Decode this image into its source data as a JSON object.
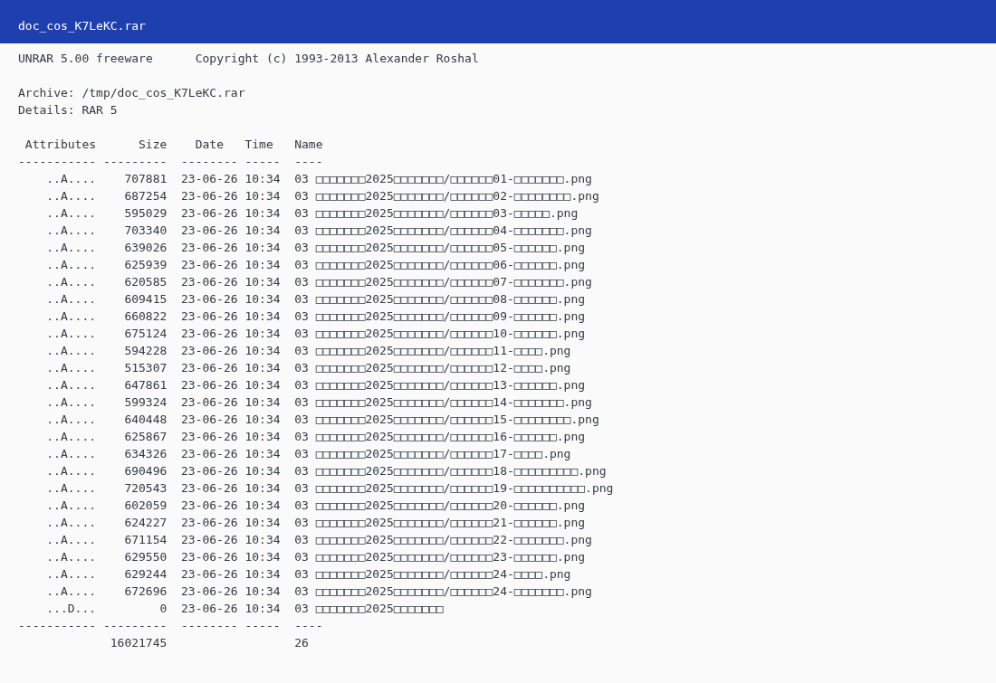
{
  "window": {
    "title": "doc_cos_K7LeKC.rar"
  },
  "banner": {
    "program": "UNRAR 5.00 freeware",
    "copyright": "Copyright (c) 1993-2013 Alexander Roshal"
  },
  "archive": {
    "archive_line": "Archive: /tmp/doc_cos_K7LeKC.rar",
    "details_line": "Details: RAR 5"
  },
  "table": {
    "columns": [
      "Attributes",
      "Size",
      "Date",
      "Time",
      "Name"
    ],
    "separator_top": [
      "-----------",
      "---------",
      "--------",
      "-----",
      "----"
    ],
    "rows": [
      {
        "attributes": "..A....",
        "size": "707881",
        "date": "23-06-26",
        "time": "10:34",
        "name": "03 □□□□□□□2025□□□□□□□/□□□□□□01-□□□□□□□.png"
      },
      {
        "attributes": "..A....",
        "size": "687254",
        "date": "23-06-26",
        "time": "10:34",
        "name": "03 □□□□□□□2025□□□□□□□/□□□□□□02-□□□□□□□□.png"
      },
      {
        "attributes": "..A....",
        "size": "595029",
        "date": "23-06-26",
        "time": "10:34",
        "name": "03 □□□□□□□2025□□□□□□□/□□□□□□03-□□□□□.png"
      },
      {
        "attributes": "..A....",
        "size": "703340",
        "date": "23-06-26",
        "time": "10:34",
        "name": "03 □□□□□□□2025□□□□□□□/□□□□□□04-□□□□□□□.png"
      },
      {
        "attributes": "..A....",
        "size": "639026",
        "date": "23-06-26",
        "time": "10:34",
        "name": "03 □□□□□□□2025□□□□□□□/□□□□□□05-□□□□□□.png"
      },
      {
        "attributes": "..A....",
        "size": "625939",
        "date": "23-06-26",
        "time": "10:34",
        "name": "03 □□□□□□□2025□□□□□□□/□□□□□□06-□□□□□□.png"
      },
      {
        "attributes": "..A....",
        "size": "620585",
        "date": "23-06-26",
        "time": "10:34",
        "name": "03 □□□□□□□2025□□□□□□□/□□□□□□07-□□□□□□□.png"
      },
      {
        "attributes": "..A....",
        "size": "609415",
        "date": "23-06-26",
        "time": "10:34",
        "name": "03 □□□□□□□2025□□□□□□□/□□□□□□08-□□□□□□.png"
      },
      {
        "attributes": "..A....",
        "size": "660822",
        "date": "23-06-26",
        "time": "10:34",
        "name": "03 □□□□□□□2025□□□□□□□/□□□□□□09-□□□□□□.png"
      },
      {
        "attributes": "..A....",
        "size": "675124",
        "date": "23-06-26",
        "time": "10:34",
        "name": "03 □□□□□□□2025□□□□□□□/□□□□□□10-□□□□□□.png"
      },
      {
        "attributes": "..A....",
        "size": "594228",
        "date": "23-06-26",
        "time": "10:34",
        "name": "03 □□□□□□□2025□□□□□□□/□□□□□□11-□□□□.png"
      },
      {
        "attributes": "..A....",
        "size": "515307",
        "date": "23-06-26",
        "time": "10:34",
        "name": "03 □□□□□□□2025□□□□□□□/□□□□□□12-□□□□.png"
      },
      {
        "attributes": "..A....",
        "size": "647861",
        "date": "23-06-26",
        "time": "10:34",
        "name": "03 □□□□□□□2025□□□□□□□/□□□□□□13-□□□□□□.png"
      },
      {
        "attributes": "..A....",
        "size": "599324",
        "date": "23-06-26",
        "time": "10:34",
        "name": "03 □□□□□□□2025□□□□□□□/□□□□□□14-□□□□□□□.png"
      },
      {
        "attributes": "..A....",
        "size": "640448",
        "date": "23-06-26",
        "time": "10:34",
        "name": "03 □□□□□□□2025□□□□□□□/□□□□□□15-□□□□□□□□.png"
      },
      {
        "attributes": "..A....",
        "size": "625867",
        "date": "23-06-26",
        "time": "10:34",
        "name": "03 □□□□□□□2025□□□□□□□/□□□□□□16-□□□□□□.png"
      },
      {
        "attributes": "..A....",
        "size": "634326",
        "date": "23-06-26",
        "time": "10:34",
        "name": "03 □□□□□□□2025□□□□□□□/□□□□□□17-□□□□.png"
      },
      {
        "attributes": "..A....",
        "size": "690496",
        "date": "23-06-26",
        "time": "10:34",
        "name": "03 □□□□□□□2025□□□□□□□/□□□□□□18-□□□□□□□□□.png"
      },
      {
        "attributes": "..A....",
        "size": "720543",
        "date": "23-06-26",
        "time": "10:34",
        "name": "03 □□□□□□□2025□□□□□□□/□□□□□□19-□□□□□□□□□□.png"
      },
      {
        "attributes": "..A....",
        "size": "602059",
        "date": "23-06-26",
        "time": "10:34",
        "name": "03 □□□□□□□2025□□□□□□□/□□□□□□20-□□□□□□.png"
      },
      {
        "attributes": "..A....",
        "size": "624227",
        "date": "23-06-26",
        "time": "10:34",
        "name": "03 □□□□□□□2025□□□□□□□/□□□□□□21-□□□□□□.png"
      },
      {
        "attributes": "..A....",
        "size": "671154",
        "date": "23-06-26",
        "time": "10:34",
        "name": "03 □□□□□□□2025□□□□□□□/□□□□□□22-□□□□□□□.png"
      },
      {
        "attributes": "..A....",
        "size": "629550",
        "date": "23-06-26",
        "time": "10:34",
        "name": "03 □□□□□□□2025□□□□□□□/□□□□□□23-□□□□□□.png"
      },
      {
        "attributes": "..A....",
        "size": "629244",
        "date": "23-06-26",
        "time": "10:34",
        "name": "03 □□□□□□□2025□□□□□□□/□□□□□□24-□□□□.png"
      },
      {
        "attributes": "..A....",
        "size": "672696",
        "date": "23-06-26",
        "time": "10:34",
        "name": "03 □□□□□□□2025□□□□□□□/□□□□□□24-□□□□□□□.png"
      },
      {
        "attributes": "...D...",
        "size": "0",
        "date": "23-06-26",
        "time": "10:34",
        "name": "03 □□□□□□□2025□□□□□□□"
      }
    ],
    "separator_bottom": [
      "-----------",
      "---------",
      "--------",
      "-----",
      "----"
    ],
    "totals": {
      "size": "16021745",
      "count": "26"
    }
  }
}
